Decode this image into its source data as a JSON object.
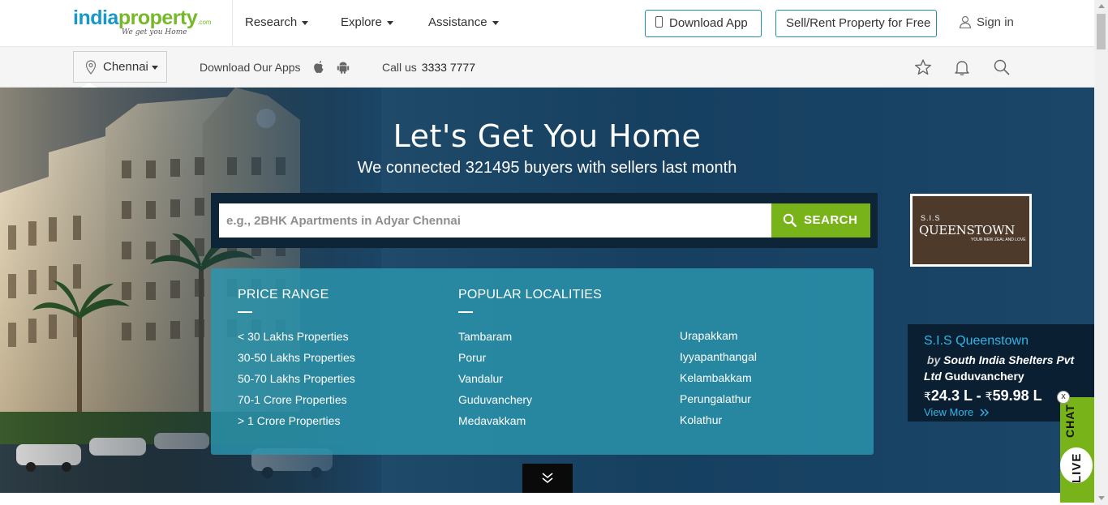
{
  "brand": {
    "part1": "india",
    "part2": "property",
    "suffix": ".com",
    "tagline": "We get you Home"
  },
  "nav": {
    "research": "Research",
    "explore": "Explore",
    "assistance": "Assistance"
  },
  "header": {
    "download_app": "Download App",
    "sell_rent": "Sell/Rent Property for Free",
    "sign_in": "Sign in"
  },
  "subbar": {
    "city": "Chennai",
    "download_apps": "Download Our Apps",
    "call_label": "Call us",
    "call_number": "3333 7777"
  },
  "hero": {
    "title": "Let's Get You Home",
    "subtitle": "We connected 321495 buyers with sellers last month",
    "search_placeholder": "e.g., 2BHK Apartments in Adyar Chennai",
    "search_button": "SEARCH"
  },
  "price_range": {
    "heading": "PRICE RANGE",
    "items": [
      "< 30 Lakhs Properties",
      "30-50 Lakhs Properties",
      "50-70 Lakhs Properties",
      "70-1 Crore Properties",
      "> 1 Crore Properties"
    ]
  },
  "localities": {
    "heading": "POPULAR LOCALITIES",
    "col1": [
      "Tambaram",
      "Porur",
      "Vandalur",
      "Guduvanchery",
      "Medavakkam"
    ],
    "col2": [
      "Urapakkam",
      "Iyyapanthangal",
      "Kelambakkam",
      "Perungalathur",
      "Kolathur"
    ]
  },
  "ad": {
    "sis": "S.I.S",
    "name": "QUEENSTOWN",
    "tagline": "YOUR NEW ZEAL AND LOVE"
  },
  "project": {
    "title": "S.I.S Queenstown",
    "by": "by",
    "builder": "South India Shelters Pvt Ltd",
    "location": "Guduvanchery",
    "currency": "₹",
    "price_min": "24.3 L -",
    "price_max": "59.98 L",
    "view_more": "View More"
  },
  "livechat": {
    "live": "LIVE",
    "chat": "CHAT",
    "close": "x"
  },
  "colors": {
    "brand_blue": "#1a97c9",
    "brand_green": "#76b82a",
    "search_green": "#79b31a",
    "panel_teal": "#2b96af"
  }
}
